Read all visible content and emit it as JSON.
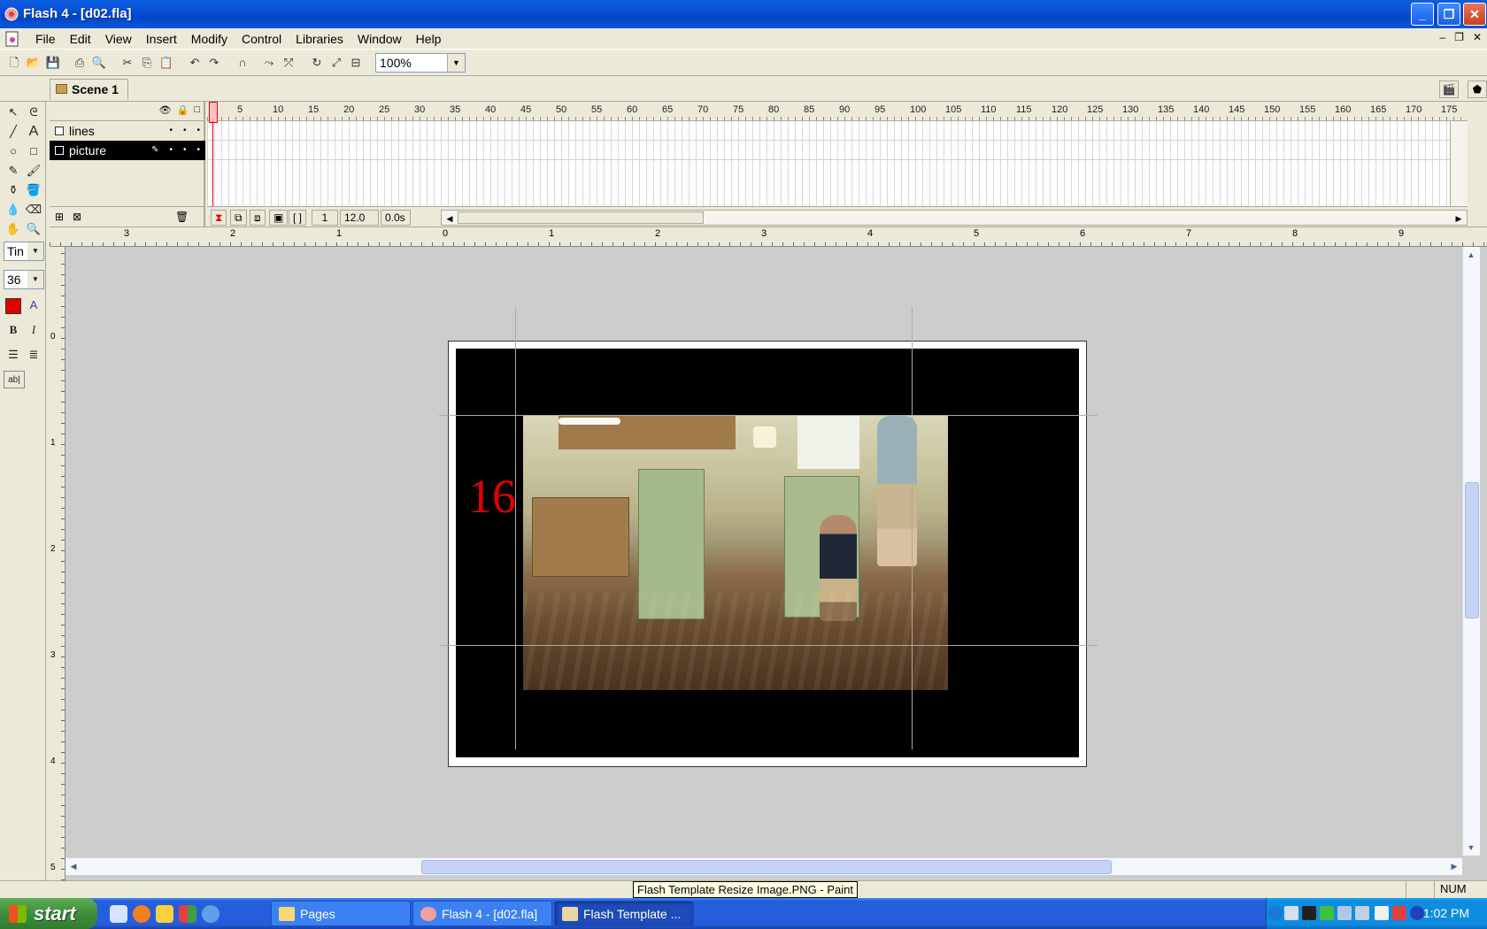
{
  "window": {
    "title": "Flash 4 - [d02.fla]",
    "buttons": {
      "minimize": "_",
      "restore": "❐",
      "close": "✕"
    }
  },
  "menu": {
    "items": [
      "File",
      "Edit",
      "View",
      "Insert",
      "Modify",
      "Control",
      "Libraries",
      "Window",
      "Help"
    ],
    "mdi": {
      "minimize": "–",
      "restore": "❐",
      "close": "✕"
    }
  },
  "toolbar": {
    "zoom": "100%"
  },
  "scene": {
    "tab_label": "Scene 1"
  },
  "tools": {
    "font_name": "Tin",
    "font_size": "36",
    "text_color": "#e00000",
    "bold": "B",
    "italic": "I",
    "field_label": "ab|",
    "text_a": "A"
  },
  "timeline": {
    "layers": [
      {
        "name": "lines",
        "selected": false
      },
      {
        "name": "picture",
        "selected": true
      }
    ],
    "frame_numbers": [
      "1",
      "5",
      "10",
      "15",
      "20",
      "25",
      "30",
      "35",
      "40",
      "45",
      "50",
      "55",
      "60",
      "65",
      "70",
      "75",
      "80",
      "85",
      "90",
      "95",
      "100",
      "105",
      "110",
      "115",
      "120",
      "125",
      "130",
      "135",
      "140",
      "145",
      "150",
      "155",
      "160",
      "165",
      "170",
      "175"
    ],
    "current_frame": "1",
    "fps": "12.0 fps",
    "elapsed": "0.0s"
  },
  "rulers": {
    "horizontal": [
      "3",
      "2",
      "1",
      "0",
      "1",
      "2",
      "3",
      "4",
      "5",
      "6",
      "7",
      "8",
      "9"
    ],
    "vertical": [
      "0",
      "1",
      "2",
      "3",
      "4",
      "5"
    ]
  },
  "stage": {
    "frame_text": "16",
    "frame_text_color": "#e00000"
  },
  "tooltip": "Flash Template Resize Image.PNG - Paint",
  "statusbar": {
    "num": "NUM"
  },
  "taskbar": {
    "start_label": "start",
    "tasks": [
      {
        "label": "Pages",
        "active": false
      },
      {
        "label": "Flash 4 - [d02.fla]",
        "active": false
      },
      {
        "label": "Flash Template ...",
        "active": true
      }
    ],
    "clock": "1:02 PM"
  }
}
